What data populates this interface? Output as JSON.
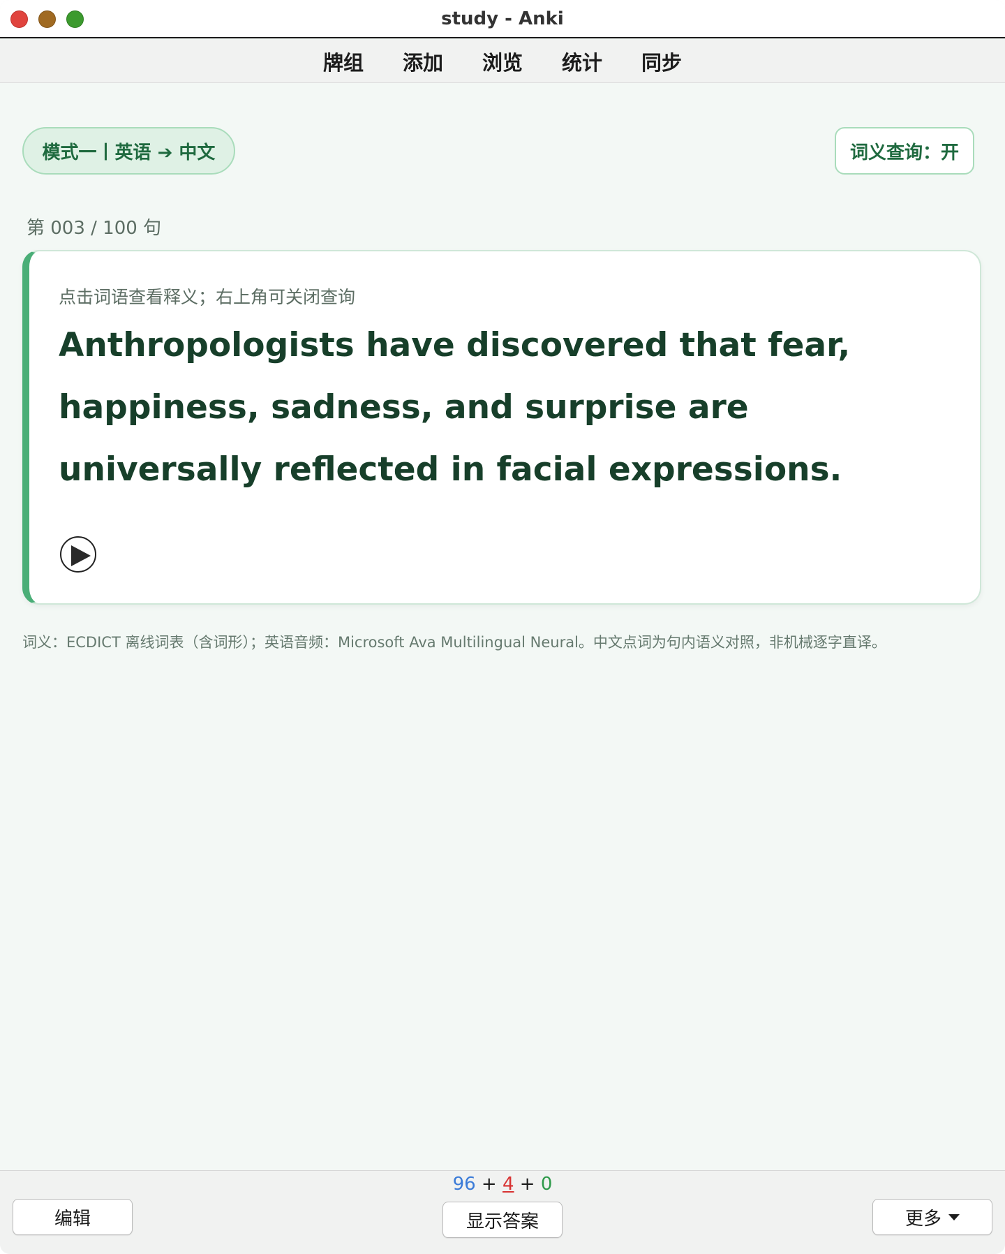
{
  "window": {
    "title": "study - Anki"
  },
  "toolbar": {
    "items": [
      "牌组",
      "添加",
      "浏览",
      "统计",
      "同步"
    ]
  },
  "mode_pill": {
    "label": "模式一丨英语 ➔ 中文"
  },
  "lookup_toggle": {
    "label": "词义查询：开"
  },
  "counter": {
    "text": "第 003 / 100 句"
  },
  "card": {
    "hint": "点击词语查看释义；右上角可关闭查询",
    "sentence": "Anthropologists have discovered that fear, happiness, sadness, and surprise are universally reflected in facial expressions.",
    "play_icon": "play-icon"
  },
  "footnote": {
    "text": "词义：ECDICT 离线词表（含词形）；英语音频：Microsoft Ava Multilingual Neural。中文点词为句内语义对照，非机械逐字直译。"
  },
  "bottom": {
    "edit_label": "编辑",
    "show_answer_label": "显示答案",
    "more_label": "更多",
    "counts": {
      "new": "96",
      "sep1": " + ",
      "learn": "4",
      "sep2": " + ",
      "review": "0"
    }
  },
  "colors": {
    "accent_green": "#4aae77",
    "pill_bg": "#dff1e5",
    "text_dark_green": "#173f2a",
    "count_new": "#3b7bd8",
    "count_learn": "#d83232",
    "count_review": "#2e9a4a"
  }
}
